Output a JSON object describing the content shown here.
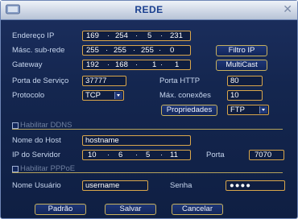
{
  "window": {
    "title": "REDE",
    "close_glyph": "✕"
  },
  "fields": {
    "ip_label": "Endereço IP",
    "ip": [
      "169",
      "254",
      "5",
      "231"
    ],
    "mask_label": "Másc. sub-rede",
    "mask": [
      "255",
      "255",
      "255",
      "0"
    ],
    "gateway_label": "Gateway",
    "gateway": [
      "192",
      "168",
      "1",
      "1"
    ],
    "service_port_label": "Porta de Serviço",
    "service_port": "37777",
    "http_port_label": "Porta HTTP",
    "http_port": "80",
    "protocol_label": "Protocolo",
    "protocol": "TCP",
    "max_conn_label": "Máx. conexões",
    "max_conn": "10",
    "ddns_label": "Habilitar DDNS",
    "host_label": "Nome do Host",
    "host": "hostname",
    "server_ip_label": "IP do Servidor",
    "server_ip": [
      "10",
      "6",
      "5",
      "11"
    ],
    "port_label": "Porta",
    "port": "7070",
    "pppoe_label": "Habilitar PPPoE",
    "user_label": "Nome Usuário",
    "user": "username",
    "pass_label": "Senha",
    "pass": "●●●●",
    "props_select": "FTP"
  },
  "buttons": {
    "filtro_ip": "Filtro IP",
    "multicast": "MultiCast",
    "propriedades": "Propriedades",
    "padrao": "Padrão",
    "salvar": "Salvar",
    "cancelar": "Cancelar"
  },
  "colors": {
    "accent": "#d9a64b",
    "panel": "#14264f",
    "title": "#1a3f8f"
  }
}
